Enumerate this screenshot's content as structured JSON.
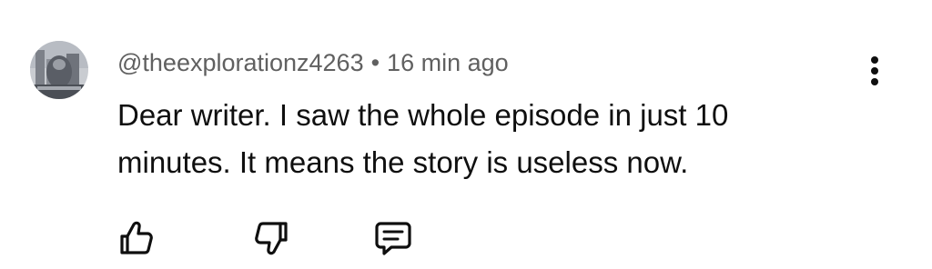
{
  "comment": {
    "author": "@theexplorationz4263",
    "separator": "•",
    "time": "16 min ago",
    "text": "Dear writer. I saw the whole episode in just 10 minutes. It means the story is useless now.",
    "avatar_icon": "avatar-photo-icon"
  },
  "actions": {
    "like_icon": "thumbs-up-icon",
    "dislike_icon": "thumbs-down-icon",
    "reply_icon": "comment-reply-icon",
    "menu_icon": "more-vertical-icon"
  },
  "colors": {
    "text_primary": "#0f0f0f",
    "text_secondary": "#606060",
    "background": "#ffffff"
  }
}
